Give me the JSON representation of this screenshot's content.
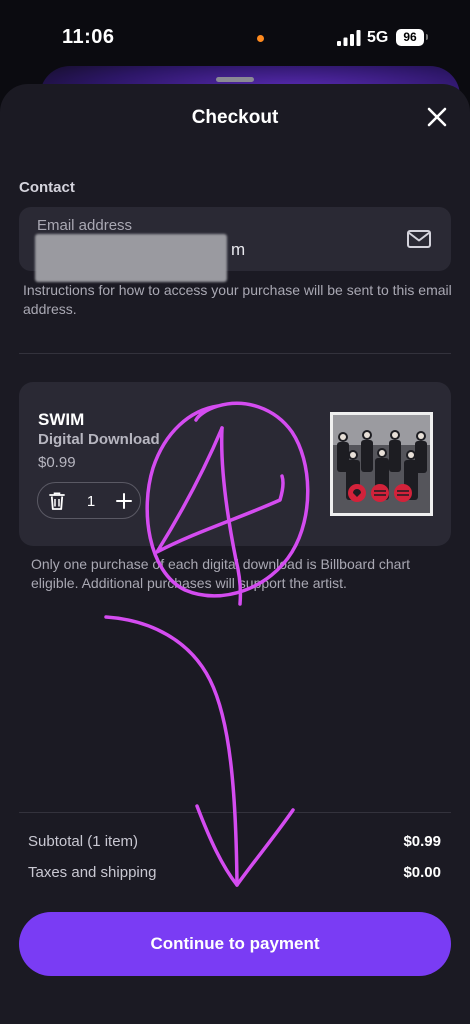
{
  "status_bar": {
    "time": "11:06",
    "network": "5G",
    "battery": "96"
  },
  "sheet": {
    "title": "Checkout"
  },
  "contact": {
    "section_label": "Contact",
    "email_label": "Email address",
    "email_value_visible": "m",
    "helper_text": "Instructions for how to access your purchase will be sent to this email address."
  },
  "product": {
    "title": "SWIM",
    "type": "Digital Download",
    "price": "$0.99",
    "quantity": "1",
    "note": "Only one purchase of each digital download is Billboard chart eligible. Additional purchases will support the artist."
  },
  "summary": {
    "subtotal_label": "Subtotal (1 item)",
    "subtotal_value": "$0.99",
    "taxes_label": "Taxes and shipping",
    "taxes_value": "$0.00"
  },
  "cta": {
    "label": "Continue to payment"
  },
  "colors": {
    "accent": "#7a3cf4",
    "annotation": "#d44cf0",
    "sheet_background": "#1b1a23",
    "card_background": "#2a2934"
  },
  "icons": [
    "signal-icon",
    "battery-icon",
    "close-icon",
    "mail-icon",
    "trash-icon",
    "plus-icon"
  ]
}
